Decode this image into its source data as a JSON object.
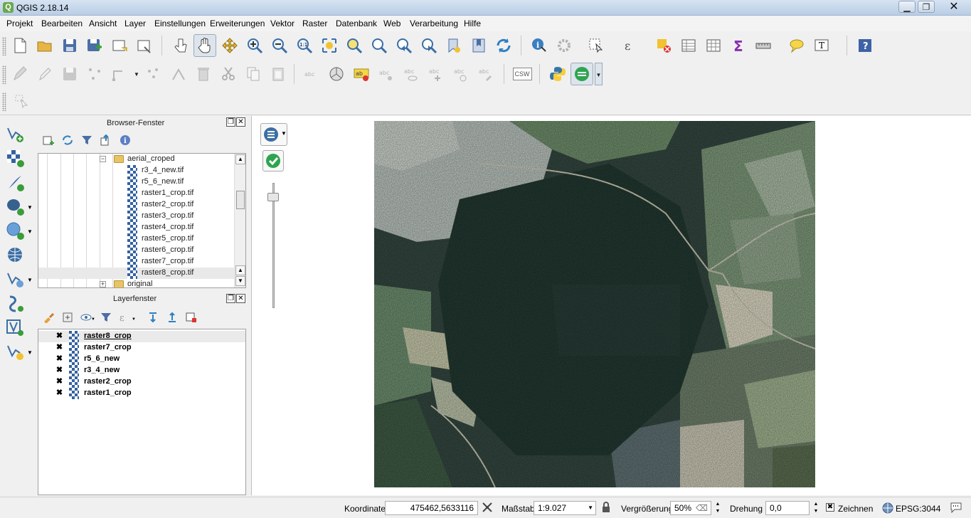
{
  "window": {
    "title": "QGIS 2.18.14",
    "minimize": "▁",
    "maximize": "❐",
    "close": "✕"
  },
  "menu": [
    "Projekt",
    "Bearbeiten",
    "Ansicht",
    "Layer",
    "Einstellungen",
    "Erweiterungen",
    "Vektor",
    "Raster",
    "Datenbank",
    "Web",
    "Verarbeitung",
    "Hilfe"
  ],
  "toolbar_icons": {
    "row1": [
      "new-project-icon",
      "open-project-icon",
      "save-project-icon",
      "save-as-icon",
      "new-print-composer-icon",
      "composer-manager-icon",
      "touch-zoom-icon",
      "pan-icon",
      "pan-to-selection-icon",
      "zoom-in-icon",
      "zoom-out-icon",
      "zoom-native-icon",
      "zoom-full-icon",
      "zoom-to-selection-icon",
      "zoom-to-layer-icon",
      "zoom-last-icon",
      "zoom-next-icon",
      "new-bookmark-icon",
      "show-bookmarks-icon",
      "refresh-icon",
      "identify-icon",
      "run-action-icon",
      "select-features-icon",
      "select-by-expression-icon",
      "deselect-icon",
      "open-attribute-table-icon",
      "field-calculator-icon",
      "statistics-icon",
      "measure-icon",
      "map-tips-icon",
      "text-annotation-icon",
      "help-icon"
    ],
    "row2": [
      "current-edits-icon",
      "toggle-editing-icon",
      "save-edits-icon",
      "add-feature-icon",
      "node-tool-icon",
      "move-feature-icon",
      "delete-selected-icon",
      "cut-features-icon",
      "copy-features-icon",
      "paste-features-icon",
      "label-toolbar-icon",
      "layer-diagram-icon",
      "highlight-pinned-icon",
      "pin-labels-icon",
      "show-hide-labels-icon",
      "move-label-icon",
      "rotate-label-icon",
      "change-label-icon",
      "csw-icon",
      "python-console-icon",
      "geoprocessing-icon"
    ]
  },
  "csw_label": "CSW",
  "browser": {
    "title": "Browser-Fenster",
    "folder": "aerial_croped",
    "files": [
      "r3_4_new.tif",
      "r5_6_new.tif",
      "raster1_crop.tif",
      "raster2_crop.tif",
      "raster3_crop.tif",
      "raster4_crop.tif",
      "raster5_crop.tif",
      "raster6_crop.tif",
      "raster7_crop.tif",
      "raster8_crop.tif"
    ],
    "next_folder": "original"
  },
  "layers": {
    "title": "Layerfenster",
    "items": [
      "raster8_crop",
      "raster7_crop",
      "r5_6_new",
      "r3_4_new",
      "raster2_crop",
      "raster1_crop"
    ],
    "check": "✖"
  },
  "status": {
    "coord_label": "Koordinate",
    "coord_value": "475462,5633116",
    "scale_label": "Maßstab",
    "scale_value": "1:9.027",
    "magnifier_label": "Vergrößerung",
    "magnifier_value": "50%",
    "rotation_label": "Drehung",
    "rotation_value": "0,0",
    "render_label": "Zeichnen",
    "render_check": "✖",
    "crs_label": "EPSG:3044"
  }
}
